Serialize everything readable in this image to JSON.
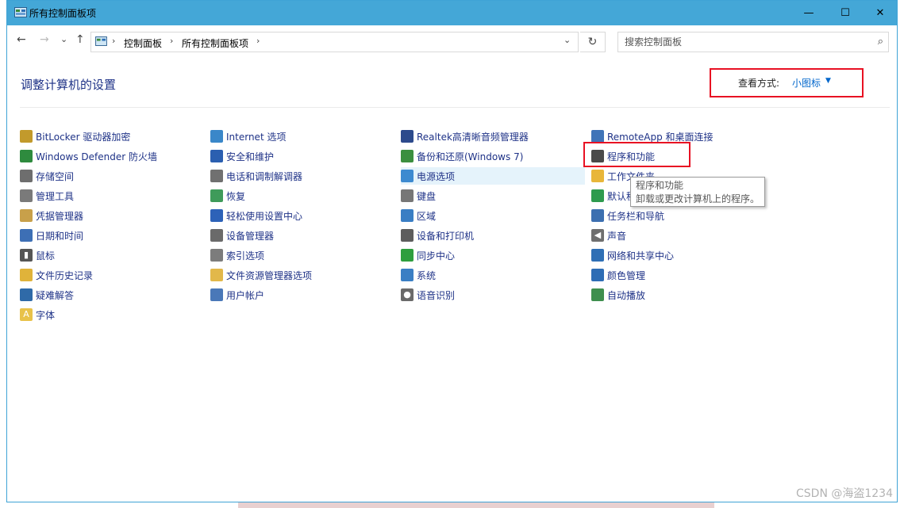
{
  "window": {
    "title": "所有控制面板项",
    "min_symbol": "—",
    "max_symbol": "☐",
    "close_symbol": "✕"
  },
  "nav": {
    "back": "←",
    "forward": "→",
    "recent": "⌄",
    "up": "↑"
  },
  "address": {
    "root_symbol": "›",
    "crumbs": [
      "控制面板",
      "所有控制面板项"
    ],
    "sep": "›",
    "drop": "⌄",
    "refresh": "↻"
  },
  "search": {
    "placeholder": "搜索控制面板",
    "icon": "⌕"
  },
  "main": {
    "heading": "调整计算机的设置",
    "view_label": "查看方式:",
    "view_value": "小图标",
    "view_caret": "▼"
  },
  "columns": [
    [
      {
        "label": "BitLocker 驱动器加密",
        "icon": "key-drive-icon",
        "color": "#c29a2c"
      },
      {
        "label": "Windows Defender 防火墙",
        "icon": "firewall-icon",
        "color": "#2e8b3e"
      },
      {
        "label": "存储空间",
        "icon": "storage-icon",
        "color": "#6e6e6e"
      },
      {
        "label": "管理工具",
        "icon": "admin-tools-icon",
        "color": "#7a7a7a"
      },
      {
        "label": "凭据管理器",
        "icon": "credential-icon",
        "color": "#c8a04a"
      },
      {
        "label": "日期和时间",
        "icon": "clock-icon",
        "color": "#3d6fb5"
      },
      {
        "label": "鼠标",
        "icon": "mouse-icon",
        "color": "#555555"
      },
      {
        "label": "文件历史记录",
        "icon": "file-history-icon",
        "color": "#e0b33a"
      },
      {
        "label": "疑难解答",
        "icon": "troubleshoot-icon",
        "color": "#2f6aa8"
      },
      {
        "label": "字体",
        "icon": "font-icon",
        "color": "#e8c24a"
      }
    ],
    [
      {
        "label": "Internet 选项",
        "icon": "internet-icon",
        "color": "#3a87c9"
      },
      {
        "label": "安全和维护",
        "icon": "flag-icon",
        "color": "#2b5fb0"
      },
      {
        "label": "电话和调制解调器",
        "icon": "phone-icon",
        "color": "#707070"
      },
      {
        "label": "恢复",
        "icon": "recovery-icon",
        "color": "#3f9b5a"
      },
      {
        "label": "轻松使用设置中心",
        "icon": "ease-access-icon",
        "color": "#2d62b8"
      },
      {
        "label": "设备管理器",
        "icon": "device-manager-icon",
        "color": "#6a6a6a"
      },
      {
        "label": "索引选项",
        "icon": "index-icon",
        "color": "#7c7c7c"
      },
      {
        "label": "文件资源管理器选项",
        "icon": "folder-options-icon",
        "color": "#e2b84a"
      },
      {
        "label": "用户帐户",
        "icon": "users-icon",
        "color": "#4a78b8"
      }
    ],
    [
      {
        "label": "Realtek高清晰音频管理器",
        "icon": "audio-manager-icon",
        "color": "#2c4a8c"
      },
      {
        "label": "备份和还原(Windows 7)",
        "icon": "backup-icon",
        "color": "#3b8f3f"
      },
      {
        "label": "电源选项",
        "icon": "power-icon",
        "color": "#3d8ad0"
      },
      {
        "label": "键盘",
        "icon": "keyboard-icon",
        "color": "#777777"
      },
      {
        "label": "区域",
        "icon": "region-icon",
        "color": "#3a7ec4"
      },
      {
        "label": "设备和打印机",
        "icon": "printer-icon",
        "color": "#5d5d5d"
      },
      {
        "label": "同步中心",
        "icon": "sync-icon",
        "color": "#2e9e3e"
      },
      {
        "label": "系统",
        "icon": "system-icon",
        "color": "#3b7fc4"
      },
      {
        "label": "语音识别",
        "icon": "microphone-icon",
        "color": "#6a6a6a"
      }
    ],
    [
      {
        "label": "RemoteApp 和桌面连接",
        "icon": "remoteapp-icon",
        "color": "#3f74b8"
      },
      {
        "label": "程序和功能",
        "icon": "programs-icon",
        "color": "#4a4a4a"
      },
      {
        "label": "工作文件夹",
        "icon": "work-folders-icon",
        "color": "#e8b63a"
      },
      {
        "label": "默认程序",
        "icon": "default-programs-icon",
        "color": "#2e9b4e"
      },
      {
        "label": "任务栏和导航",
        "icon": "taskbar-icon",
        "color": "#3c6fb0"
      },
      {
        "label": "声音",
        "icon": "speaker-icon",
        "color": "#6f6f6f"
      },
      {
        "label": "网络和共享中心",
        "icon": "network-icon",
        "color": "#2f6fb5"
      },
      {
        "label": "颜色管理",
        "icon": "color-management-icon",
        "color": "#2e6db5"
      },
      {
        "label": "自动播放",
        "icon": "autoplay-icon",
        "color": "#3e8f4e"
      }
    ]
  ],
  "tooltip": {
    "title": "程序和功能",
    "desc": "卸载或更改计算机上的程序。"
  },
  "watermark": "CSDN @海盗1234",
  "colors": {
    "titlebar": "#44a7d7",
    "link": "#1e3287",
    "highlight": "#e5f3fb",
    "annotation": "#e81123"
  }
}
